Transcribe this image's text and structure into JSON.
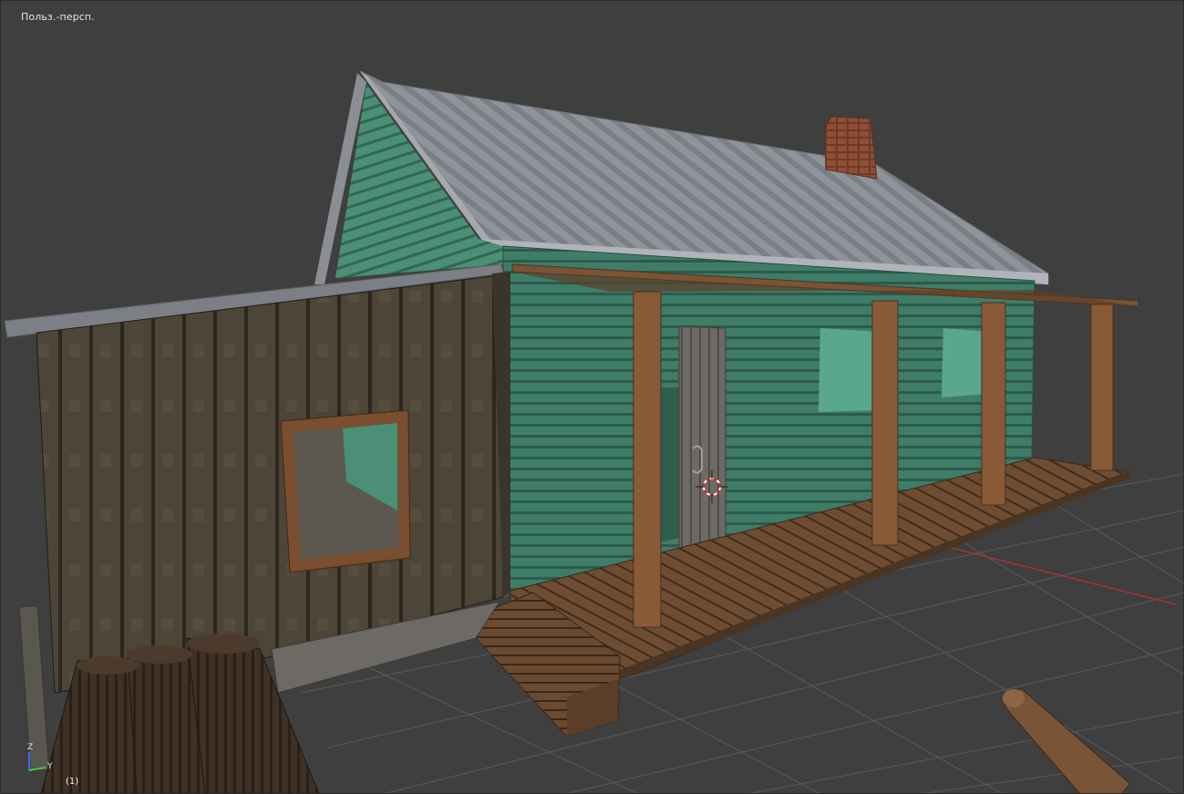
{
  "viewport": {
    "view_label": "Польз.-персп.",
    "frame_label": "(1)"
  },
  "axes_gizmo": {
    "z_label": "Z",
    "y_label": "Y",
    "z_color": "#3b6cff",
    "y_color": "#46c846"
  },
  "colors": {
    "background": "#3f3f3f",
    "grid": "#5a5a5a",
    "x_axis": "#b83232",
    "roof": "#8c9096",
    "wall_green": "#3e7a66",
    "wood_dark": "#4a3e30",
    "wood_plank": "#6b4a30",
    "post": "#8a5a36",
    "chimney": "#8a4a34",
    "log": "#3e3024"
  },
  "icons": {
    "cursor": "3d-cursor-icon",
    "gizmo": "axes-gizmo-icon"
  }
}
